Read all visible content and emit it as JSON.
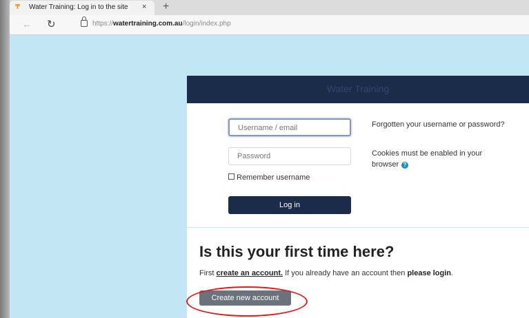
{
  "browser": {
    "tab_title": "Water Training: Log in to the site",
    "tab_close": "×",
    "new_tab": "+",
    "url_prefix": "https://",
    "url_domain": "watertraining.com.au",
    "url_path": "/login/index.php"
  },
  "login": {
    "header_title": "Water Training",
    "username_placeholder": "Username / email",
    "password_placeholder": "Password",
    "remember_label": "Remember username",
    "login_button": "Log in",
    "forgot_link": "Forgotten your username or password?",
    "cookies_text": "Cookies must be enabled in your browser"
  },
  "signup": {
    "title": "Is this your first time here?",
    "text_before": "First ",
    "create_link": "create an account.",
    "text_middle": " If you already have an account then ",
    "login_link": "please login",
    "text_end": ".",
    "create_button": "Create new account"
  },
  "colors": {
    "page_background": "#c2e6f3",
    "header_navy": "#1b2b4a",
    "highlight_ellipse": "#e2191b"
  }
}
